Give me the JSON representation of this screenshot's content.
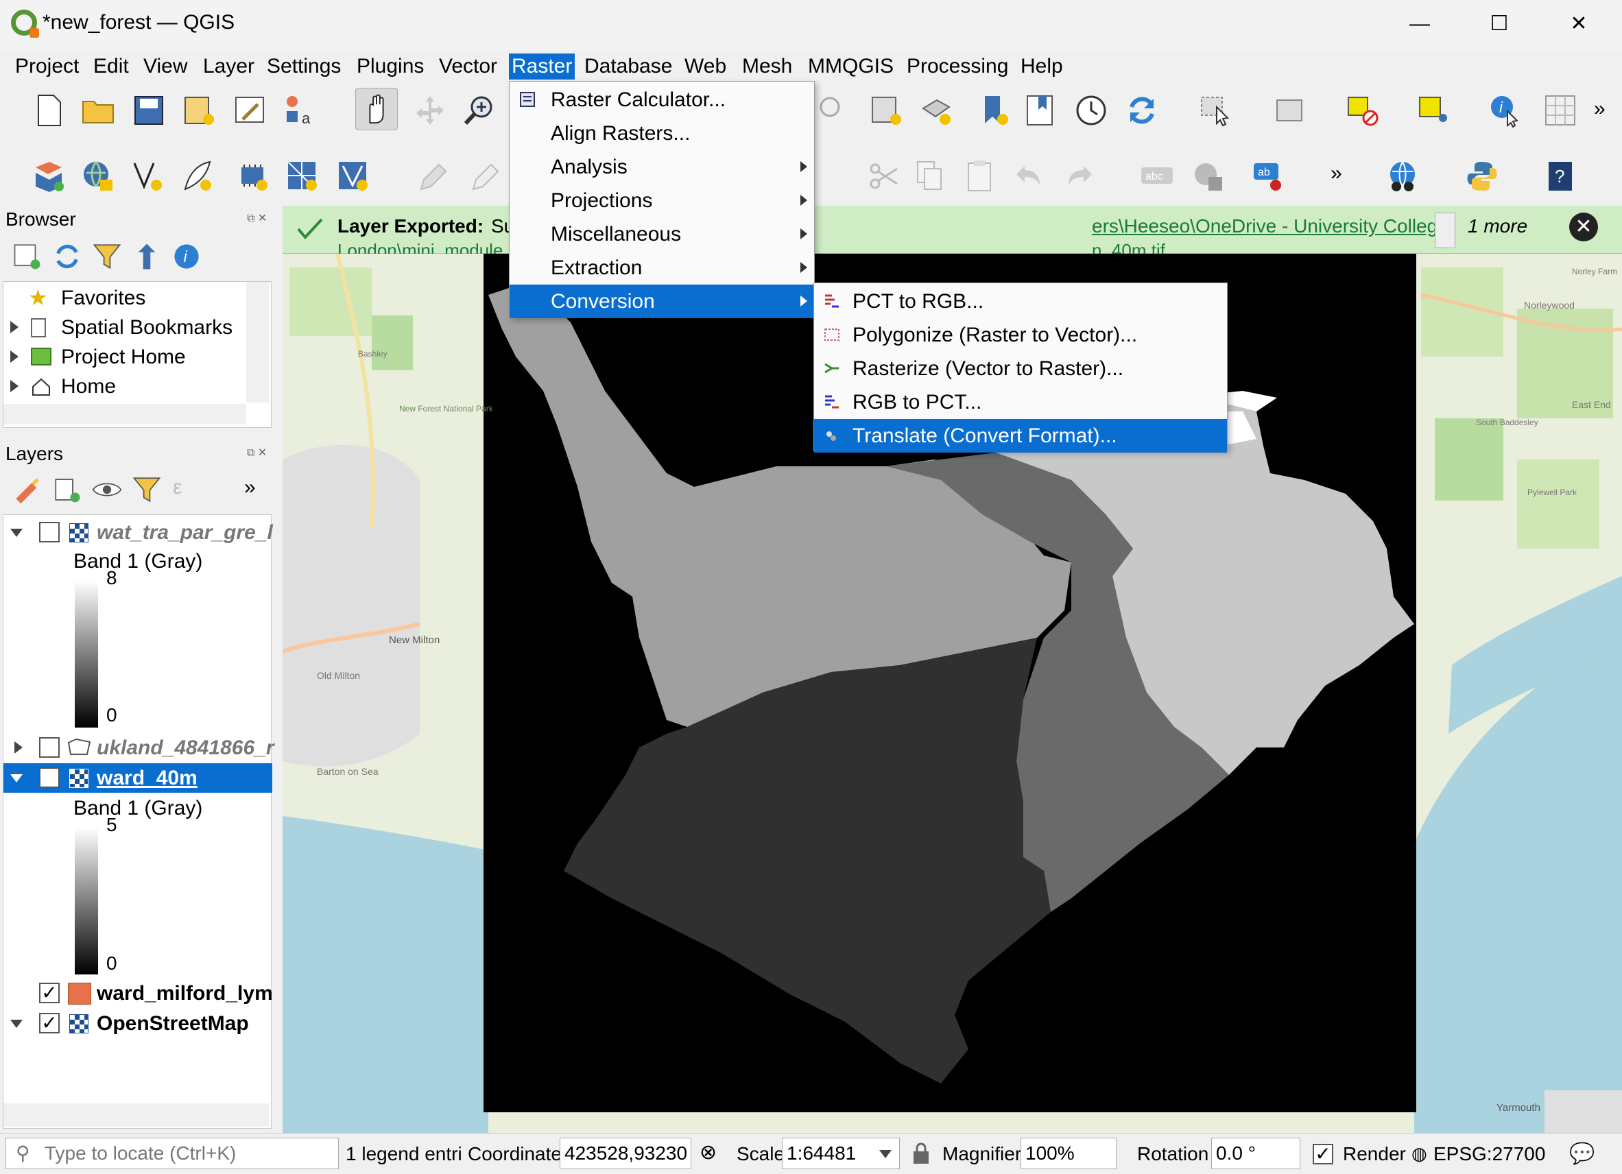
{
  "window": {
    "title": "*new_forest — QGIS",
    "controls": {
      "minimize": "—",
      "maximize": "☐",
      "close": "✕"
    }
  },
  "menubar": [
    "Project",
    "Edit",
    "View",
    "Layer",
    "Settings",
    "Plugins",
    "Vector",
    "Raster",
    "Database",
    "Web",
    "Mesh",
    "MMQGIS",
    "Processing",
    "Help"
  ],
  "raster_menu": {
    "items": [
      "Raster Calculator...",
      "Align Rasters...",
      "Analysis",
      "Projections",
      "Miscellaneous",
      "Extraction",
      "Conversion"
    ],
    "highlighted": "Conversion"
  },
  "conversion_submenu": {
    "items": [
      "PCT to RGB...",
      "Polygonize (Raster to Vector)...",
      "Rasterize (Vector to Raster)...",
      "RGB to PCT...",
      "Translate (Convert Format)..."
    ],
    "highlighted": "Translate (Convert Format)..."
  },
  "message_bar": {
    "title": "Layer Exported:",
    "text_visible": "Su",
    "link_line1": "ers\\Heeseo\\OneDrive - University College",
    "line2_left": "London\\mini_module",
    "line2_right": "n_40m.tif",
    "more": "1 more"
  },
  "browser": {
    "title": "Browser",
    "items": [
      "Favorites",
      "Spatial Bookmarks",
      "Project Home",
      "Home"
    ]
  },
  "layers": {
    "title": "Layers",
    "items": [
      {
        "name": "wat_tra_par_gre_l",
        "checked": false,
        "band": "Band 1 (Gray)",
        "max": "8",
        "min": "0"
      },
      {
        "name": "ukland_4841866_r",
        "checked": false
      },
      {
        "name": "ward_40m",
        "checked": true,
        "selected": true,
        "band": "Band 1 (Gray)",
        "max": "5",
        "min": "0"
      },
      {
        "name": "ward_milford_lym",
        "checked": true,
        "swatch": "#e8734a"
      },
      {
        "name": "OpenStreetMap",
        "checked": true
      }
    ],
    "check_glyph": "✓"
  },
  "map_labels": [
    "New Milton",
    "Old Milton",
    "Barton on Sea",
    "Bashley",
    "Norleywood",
    "East End",
    "South Baddesley",
    "Yarmouth",
    "Norley Farm",
    "Pylewell Park",
    "New Forest National Park"
  ],
  "statusbar": {
    "locate_placeholder": "Type to locate (Ctrl+K)",
    "legend": "1 legend entri",
    "coordinate_label": "Coordinate",
    "coordinate_value": "423528,93230",
    "scale_label": "Scale",
    "scale_value": "1:64481",
    "magnifier_label": "Magnifier",
    "magnifier_value": "100%",
    "rotation_label": "Rotation",
    "rotation_value": "0.0 °",
    "render_label": "Render",
    "crs": "EPSG:27700"
  },
  "colors": {
    "accent": "#0a6ed1",
    "message_bg": "#cfecc4",
    "qgis_green": "#589632"
  }
}
